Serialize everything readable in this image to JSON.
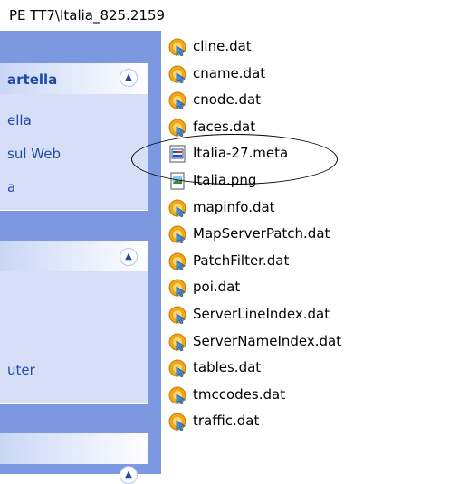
{
  "address_bar": {
    "path": "PE TT7\\Italia_825.2159"
  },
  "task_pane": {
    "group1": {
      "title": "artella",
      "tasks": [
        "ella",
        "sul Web",
        "a"
      ]
    },
    "group2": {
      "tasks": [
        "uter"
      ]
    }
  },
  "files": [
    {
      "name": "cline.dat",
      "icon": "dat-file-icon"
    },
    {
      "name": "cname.dat",
      "icon": "dat-file-icon"
    },
    {
      "name": "cnode.dat",
      "icon": "dat-file-icon"
    },
    {
      "name": "faces.dat",
      "icon": "dat-file-icon"
    },
    {
      "name": "Italia-27.meta",
      "icon": "meta-file-icon"
    },
    {
      "name": "Italia.png",
      "icon": "png-image-icon"
    },
    {
      "name": "mapinfo.dat",
      "icon": "dat-file-icon"
    },
    {
      "name": "MapServerPatch.dat",
      "icon": "dat-file-icon"
    },
    {
      "name": "PatchFilter.dat",
      "icon": "dat-file-icon"
    },
    {
      "name": "poi.dat",
      "icon": "dat-file-icon"
    },
    {
      "name": "ServerLineIndex.dat",
      "icon": "dat-file-icon"
    },
    {
      "name": "ServerNameIndex.dat",
      "icon": "dat-file-icon"
    },
    {
      "name": "tables.dat",
      "icon": "dat-file-icon"
    },
    {
      "name": "tmccodes.dat",
      "icon": "dat-file-icon"
    },
    {
      "name": "traffic.dat",
      "icon": "dat-file-icon"
    }
  ],
  "colors": {
    "task_pane_bg": "#7b98e0",
    "group_body_bg": "#d6dff7",
    "link_text": "#214aa5",
    "dat_icon_orange": "#f2a61b",
    "dat_icon_blue": "#3a8ee6"
  }
}
